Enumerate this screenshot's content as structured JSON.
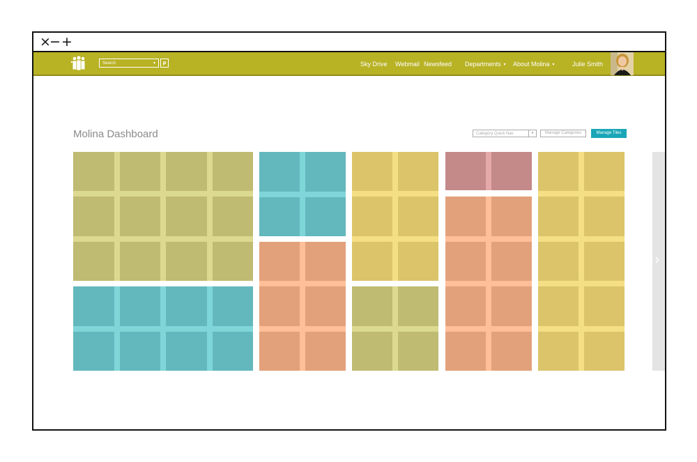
{
  "window_controls": {
    "close": "×",
    "minimize": "−",
    "maximize": "+"
  },
  "navbar": {
    "logo_icon": "people-logo-icon",
    "search_placeholder": "Search",
    "search_dropdown_glyph": "▾",
    "search_button_glyph": "ρ",
    "links": [
      {
        "label": "Sky Drive",
        "caret": ""
      },
      {
        "label": "Webmail",
        "caret": ""
      },
      {
        "label": "Newsfeed",
        "caret": ""
      },
      {
        "label": "Departments",
        "caret": "▾"
      },
      {
        "label": "About Molina",
        "caret": "▾"
      }
    ],
    "user_name": "Julie Smith",
    "avatar_icon": "user-avatar-photo"
  },
  "dashboard": {
    "title": "Molina Dashboard",
    "category_quick_nav": "Category Quick Nav",
    "category_quick_nav_arrow": "▾",
    "manage_categories_label": "Manage Categories",
    "manage_tiles_label": "Manage Tiles",
    "next_page_glyph": "›"
  },
  "colors": {
    "nav_bg": "#b8b225",
    "olive": "#bfbb72",
    "olive_line": "#dcd990",
    "teal": "#63b8bd",
    "teal_line": "#7fd6d8",
    "orange": "#e3a17b",
    "orange_line": "#ffbf98",
    "yellow": "#dbc46a",
    "yellow_line": "#f5df85",
    "rose": "#c48989",
    "rose_line": "#e6a9a9",
    "manage_tiles_bg": "#1aa6b7"
  },
  "tile_groups": [
    {
      "name": "olive-grid",
      "color": "olive",
      "rows": 3,
      "cols": 4
    },
    {
      "name": "teal-grid-wide",
      "color": "teal",
      "rows": 2,
      "cols": 4
    },
    {
      "name": "teal-grid-small",
      "color": "teal",
      "rows": 2,
      "cols": 2
    },
    {
      "name": "orange-grid-col2",
      "color": "orange",
      "rows": 3,
      "cols": 2
    },
    {
      "name": "yellow-grid-col3",
      "color": "yellow",
      "rows": 3,
      "cols": 2
    },
    {
      "name": "olive-grid-col3",
      "color": "olive",
      "rows": 2,
      "cols": 2
    },
    {
      "name": "rose-grid",
      "color": "rose",
      "rows": 1,
      "cols": 2
    },
    {
      "name": "orange-grid-col4",
      "color": "orange",
      "rows": 4,
      "cols": 2
    },
    {
      "name": "yellow-grid-col5",
      "color": "yellow",
      "rows": 5,
      "cols": 2
    }
  ]
}
